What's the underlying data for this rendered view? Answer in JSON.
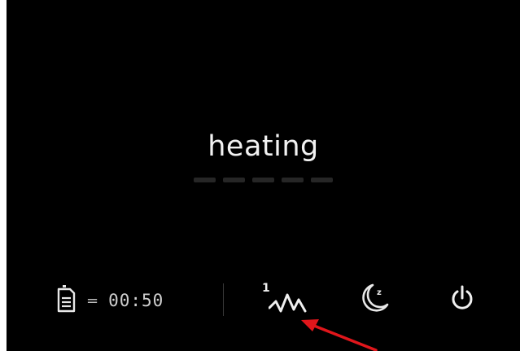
{
  "display": {
    "status": "heating",
    "progress_segments": 5
  },
  "bottom_bar": {
    "timer": {
      "icon": "filter-document-icon",
      "symbol": "=",
      "value": "00:50"
    },
    "mode": {
      "icon": "heating-mode-wave-icon",
      "level": "1"
    },
    "night_mode": {
      "icon": "moon-sleep-icon"
    },
    "power": {
      "icon": "power-icon"
    }
  },
  "annotation": {
    "icon": "red-arrow-icon",
    "color": "#e0161b"
  }
}
